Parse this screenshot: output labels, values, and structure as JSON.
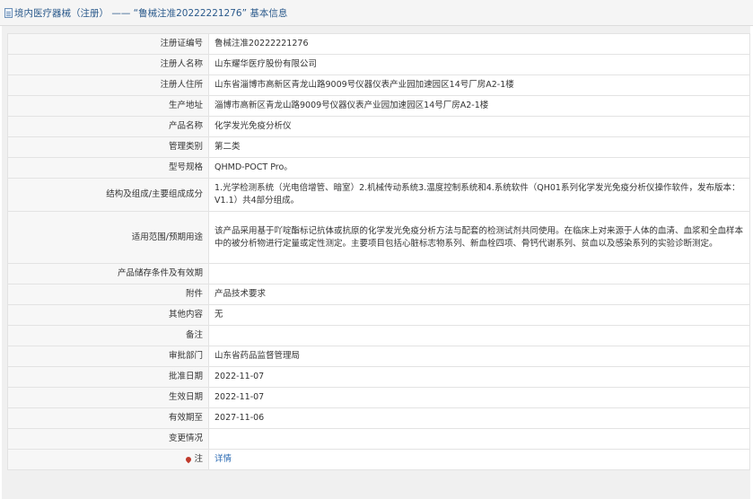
{
  "header": {
    "title": "境内医疗器械（注册） —— “鲁械注准20222221276” 基本信息"
  },
  "rows": [
    {
      "label": "注册证编号",
      "value": "鲁械注准20222221276"
    },
    {
      "label": "注册人名称",
      "value": "山东耀华医疗股份有限公司"
    },
    {
      "label": "注册人住所",
      "value": "山东省淄博市高新区青龙山路9009号仪器仪表产业园加速园区14号厂房A2-1楼"
    },
    {
      "label": "生产地址",
      "value": "淄博市高新区青龙山路9009号仪器仪表产业园加速园区14号厂房A2-1楼"
    },
    {
      "label": "产品名称",
      "value": "化学发光免疫分析仪"
    },
    {
      "label": "管理类别",
      "value": "第二类"
    },
    {
      "label": "型号规格",
      "value": "QHMD-POCT Pro。"
    },
    {
      "label": "结构及组成/主要组成成分",
      "value": "1.光学检测系统（光电倍增管、暗室）2.机械传动系统3.温度控制系统和4.系统软件（QH01系列化学发光免疫分析仪操作软件，发布版本：V1.1）共4部分组成。"
    },
    {
      "label": "适用范围/预期用途",
      "value": "该产品采用基于吖啶酯标记抗体或抗原的化学发光免疫分析方法与配套的检测试剂共同使用。在临床上对来源于人体的血清、血浆和全血样本中的被分析物进行定量或定性测定。主要项目包括心脏标志物系列、新血栓四项、骨钙代谢系列、贫血以及感染系列的实验诊断测定。"
    },
    {
      "label": "产品储存条件及有效期",
      "value": ""
    },
    {
      "label": "附件",
      "value": "产品技术要求"
    },
    {
      "label": "其他内容",
      "value": "无"
    },
    {
      "label": "备注",
      "value": ""
    },
    {
      "label": "审批部门",
      "value": "山东省药品监督管理局"
    },
    {
      "label": "批准日期",
      "value": "2022-11-07"
    },
    {
      "label": "生效日期",
      "value": "2022-11-07"
    },
    {
      "label": "有效期至",
      "value": "2027-11-06"
    },
    {
      "label": "变更情况",
      "value": ""
    },
    {
      "label": "注",
      "value": "详情"
    }
  ]
}
